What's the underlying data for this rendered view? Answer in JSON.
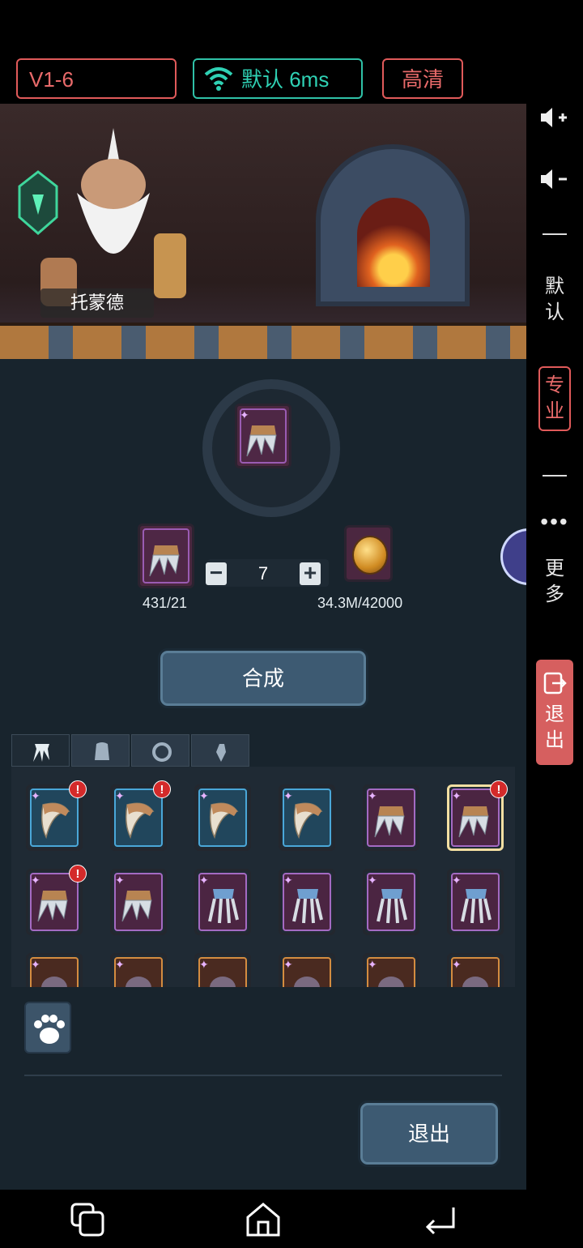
{
  "topbar": {
    "version": "V1-6",
    "network_label": "默认 6ms",
    "quality_label": "高清"
  },
  "sidebar": {
    "volume_up_icon": "volume-up",
    "volume_down_icon": "volume-down",
    "default_label": "默认",
    "pro_label": "专业",
    "more_label": "更多",
    "exit_label": "退出"
  },
  "scene": {
    "npc_name": "托蒙德"
  },
  "craft": {
    "material_count": "431/21",
    "quantity": "7",
    "coin_count": "34.3M/42000",
    "craft_button": "合成",
    "minus": "−",
    "plus": "+"
  },
  "inventory": {
    "tabs": [
      "claw-weapon",
      "armor",
      "ring",
      "accessory"
    ],
    "rows": [
      [
        {
          "type": "fang",
          "rarity": "blue",
          "alert": true
        },
        {
          "type": "fang",
          "rarity": "blue",
          "alert": true
        },
        {
          "type": "fang",
          "rarity": "blue",
          "alert": false
        },
        {
          "type": "fang",
          "rarity": "blue",
          "alert": false
        },
        {
          "type": "claw",
          "rarity": "purple",
          "alert": false
        },
        {
          "type": "claw",
          "rarity": "purple",
          "alert": true,
          "selected": true
        }
      ],
      [
        {
          "type": "claw",
          "rarity": "purple",
          "alert": true
        },
        {
          "type": "claw",
          "rarity": "purple",
          "alert": false
        },
        {
          "type": "talon",
          "rarity": "purple",
          "alert": false
        },
        {
          "type": "talon",
          "rarity": "purple",
          "alert": false
        },
        {
          "type": "talon",
          "rarity": "purple",
          "alert": false
        },
        {
          "type": "talon",
          "rarity": "purple",
          "alert": false
        }
      ],
      [
        {
          "type": "item",
          "rarity": "orange",
          "alert": false
        },
        {
          "type": "item",
          "rarity": "orange",
          "alert": false
        },
        {
          "type": "item",
          "rarity": "orange",
          "alert": false
        },
        {
          "type": "item",
          "rarity": "orange",
          "alert": false
        },
        {
          "type": "item",
          "rarity": "orange",
          "alert": false
        },
        {
          "type": "item",
          "rarity": "orange",
          "alert": false
        }
      ]
    ],
    "alert_mark": "!"
  },
  "footer": {
    "exit_button": "退出"
  },
  "colors": {
    "accent_red": "#e05a5a",
    "accent_teal": "#2fc1a7",
    "button_blue": "#3d5a72"
  }
}
